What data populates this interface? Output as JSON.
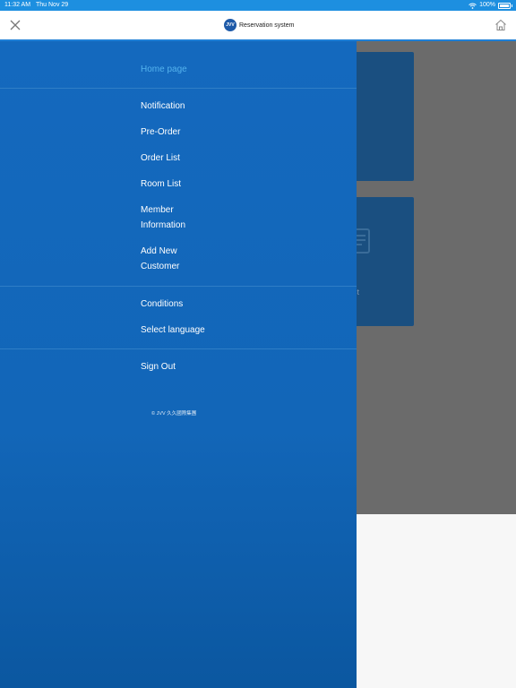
{
  "status_bar": {
    "time": "11:32 AM",
    "date": "Thu Nov 29",
    "battery": "100%"
  },
  "header": {
    "logo_text": "JVV",
    "title": "Reservation system"
  },
  "background": {
    "card2_label": "st"
  },
  "drawer": {
    "home": "Home page",
    "group1": {
      "notification": "Notification",
      "pre_order": "Pre-Order",
      "order_list": "Order List",
      "room_list": "Room List",
      "member_info_line1": "Member",
      "member_info_line2": "Information",
      "add_customer_line1": "Add New",
      "add_customer_line2": "Customer"
    },
    "group2": {
      "conditions": "Conditions",
      "select_language": "Select language"
    },
    "sign_out": "Sign Out",
    "copyright": "©  JVV 久久國際集團"
  },
  "colors": {
    "drawer_blue": "#1469be",
    "active_item": "#54b3ee",
    "status_bar": "#1d8fe0"
  }
}
